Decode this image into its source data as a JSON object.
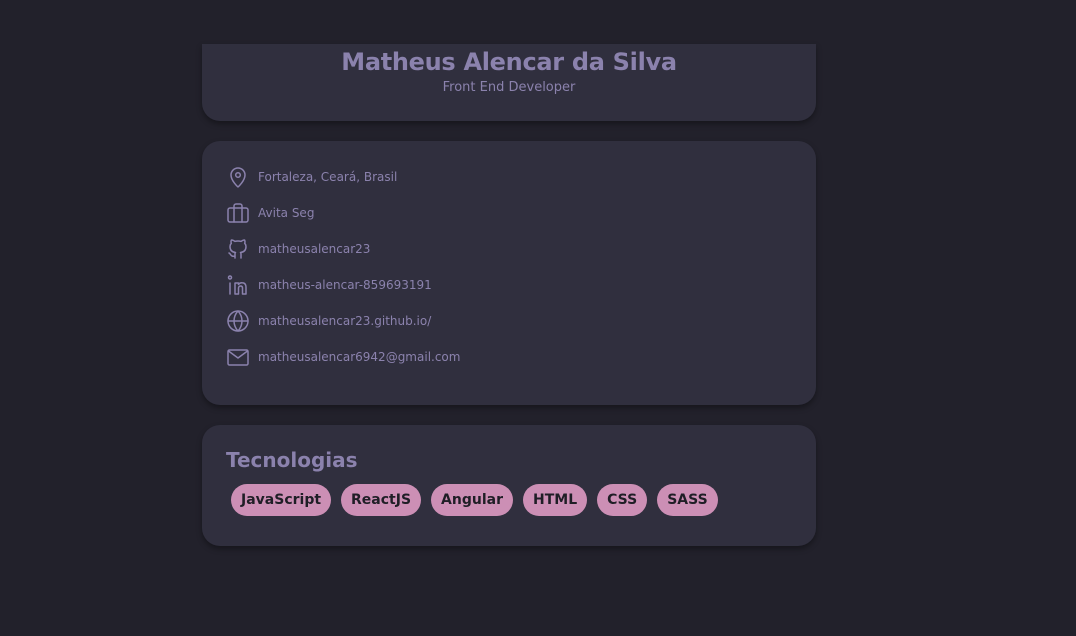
{
  "profile": {
    "name": "Matheus Alencar da Silva",
    "role": "Front End Developer"
  },
  "info": {
    "location": "Fortaleza, Ceará, Brasil",
    "company": "Avita Seg",
    "github": "matheusalencar23",
    "linkedin": "matheus-alencar-859693191",
    "website": "matheusalencar23.github.io/",
    "email": "matheusalencar6942@gmail.com"
  },
  "technologies": {
    "title": "Tecnologias",
    "tags": [
      "JavaScript",
      "ReactJS",
      "Angular",
      "HTML",
      "CSS",
      "SASS"
    ]
  },
  "icons": [
    "map-pin-icon",
    "briefcase-icon",
    "github-icon",
    "linkedin-icon",
    "globe-icon",
    "mail-icon"
  ],
  "colors": {
    "background": "#22212b",
    "card": "#302f3e",
    "text": "#8b82ad",
    "tag": "#cc8fb5",
    "tag_text": "#1f1e26"
  }
}
